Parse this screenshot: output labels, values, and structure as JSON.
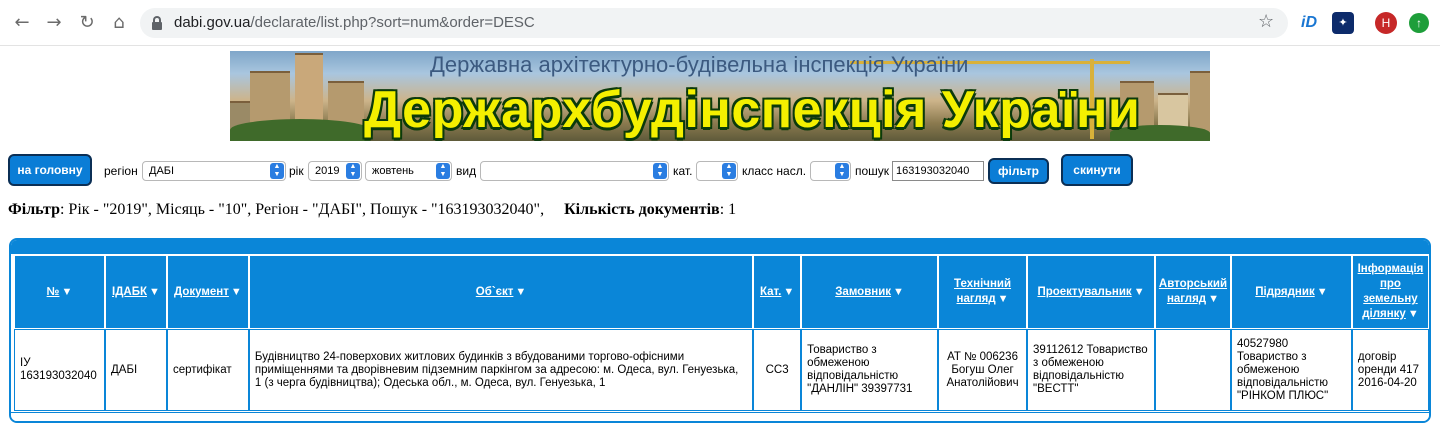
{
  "browser": {
    "url_host": "dabi.gov.ua",
    "url_path": "/declarate/list.php?sort=num&order=DESC",
    "avatar_letter": "H"
  },
  "banner": {
    "subtitle": "Державна архітектурно-будівельна інспекція України",
    "title": "Держархбудінспекція України"
  },
  "filter_bar": {
    "home_button": "на головну",
    "region_label": "регіон",
    "region_value": "ДАБІ",
    "year_label": "рік",
    "year_value": "2019",
    "month_value": "жовтень",
    "type_label": "вид",
    "type_value": "",
    "cat_label": "кат.",
    "cat_value": "",
    "class_label": "класс насл.",
    "class_value": "",
    "search_label": "пошук",
    "search_value": "163193032040",
    "filter_button": "фільтр",
    "reset_button": "скинути"
  },
  "summary": {
    "filter_label": "Фільтр",
    "filter_text": ": Рік - \"2019\", Місяць - \"10\", Регіон - \"ДАБІ\", Пошук - \"163193032040\",",
    "count_label": "Кількість документів",
    "count_value": ": 1"
  },
  "table": {
    "columns": [
      "№",
      "ІДАБК",
      "Документ",
      "Об`єкт",
      "Кат.",
      "Замовник",
      "Технічний нагляд",
      "Проектувальник",
      "Авторський нагляд",
      "Підрядник",
      "Інформація про земельну ділянку"
    ],
    "rows": [
      {
        "num": "ІУ 163193032040",
        "idabk": "ДАБІ",
        "document": "сертифікат",
        "object": "Будівництво 24-поверхових житлових будинків з вбудованими торгово-офісними приміщеннями та дворівневим підземним паркінгом за адресою: м. Одеса, вул. Генуезька, 1 (з черга будівництва); Одеська обл., м. Одеса, вул. Генуезька, 1",
        "cat": "СС3",
        "customer": "Товариство з обмеженою відповідальністю \"ДАНЛІН\" 39397731",
        "tech_supervision": "АТ № 006236 Богуш Олег Анатолійович",
        "designer": "39112612 Товариство з обмеженою відповідальністю \"ВЕСТТ\"",
        "author_supervision": "",
        "contractor": "40527980 Товариство з обмеженою відповідальністю \"РІНКОМ ПЛЮС\"",
        "land_info": "договір оренди 417 2016-04-20"
      }
    ]
  }
}
